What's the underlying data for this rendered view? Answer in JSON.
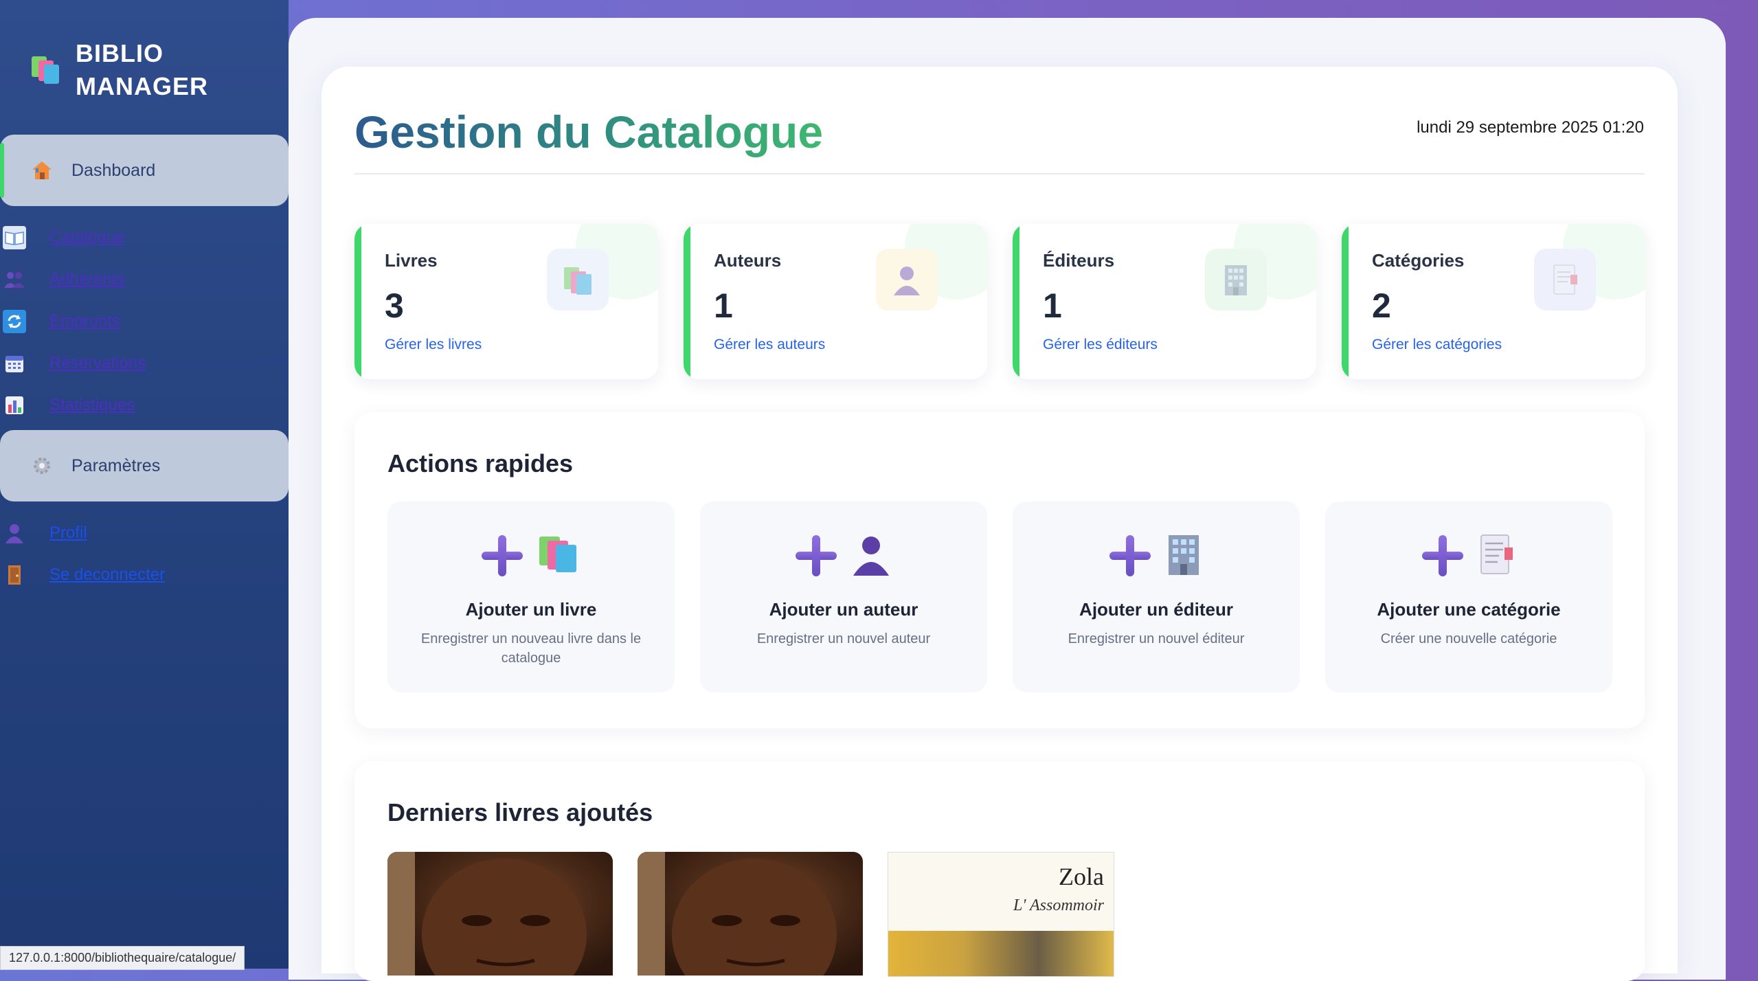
{
  "brand": {
    "line1": "BIBLIO",
    "line2": "MANAGER"
  },
  "sidebar": {
    "active": {
      "label": "Dashboard",
      "icon": "house-icon"
    },
    "links": [
      {
        "label": "Catalogue",
        "icon": "open-book-icon"
      },
      {
        "label": "Adhérents",
        "icon": "people-icon"
      },
      {
        "label": "Emprunts",
        "icon": "refresh-icon"
      },
      {
        "label": "Réservations",
        "icon": "calendar-icon"
      },
      {
        "label": "Statistiques",
        "icon": "bar-chart-icon"
      }
    ],
    "settings": {
      "label": "Paramètres",
      "icon": "gear-icon"
    },
    "profile": {
      "label": "Profil",
      "icon": "user-icon"
    },
    "logout": {
      "label": "Se deconnecter",
      "icon": "door-icon"
    }
  },
  "status_url": "127.0.0.1:8000/bibliothequaire/catalogue/",
  "header": {
    "title": "Gestion du Catalogue",
    "datetime": "lundi 29 septembre 2025 01:20"
  },
  "stats": [
    {
      "label": "Livres",
      "value": "3",
      "link": "Gérer les livres",
      "icon": "books-icon"
    },
    {
      "label": "Auteurs",
      "value": "1",
      "link": "Gérer les auteurs",
      "icon": "person-icon"
    },
    {
      "label": "Éditeurs",
      "value": "1",
      "link": "Gérer les éditeurs",
      "icon": "building-icon"
    },
    {
      "label": "Catégories",
      "value": "2",
      "link": "Gérer les catégories",
      "icon": "bookmark-document-icon"
    }
  ],
  "quick_actions": {
    "title": "Actions rapides",
    "items": [
      {
        "title": "Ajouter un livre",
        "desc": "Enregistrer un nouveau livre dans le catalogue",
        "icon": "books-icon"
      },
      {
        "title": "Ajouter un auteur",
        "desc": "Enregistrer un nouvel auteur",
        "icon": "person-icon"
      },
      {
        "title": "Ajouter un éditeur",
        "desc": "Enregistrer un nouvel éditeur",
        "icon": "building-icon"
      },
      {
        "title": "Ajouter une catégorie",
        "desc": "Créer une nouvelle catégorie",
        "icon": "bookmark-document-icon"
      }
    ]
  },
  "recent_books": {
    "title": "Derniers livres ajoutés",
    "books": [
      {
        "cover": "photo-portrait"
      },
      {
        "cover": "photo-portrait"
      },
      {
        "author": "Zola",
        "title": "L' Assommoir"
      }
    ]
  },
  "colors": {
    "accent_green": "#3dd76a",
    "link_blue": "#2563eb",
    "sidebar_bg": "#26427e",
    "plus_purple": "#7a5ad0"
  }
}
